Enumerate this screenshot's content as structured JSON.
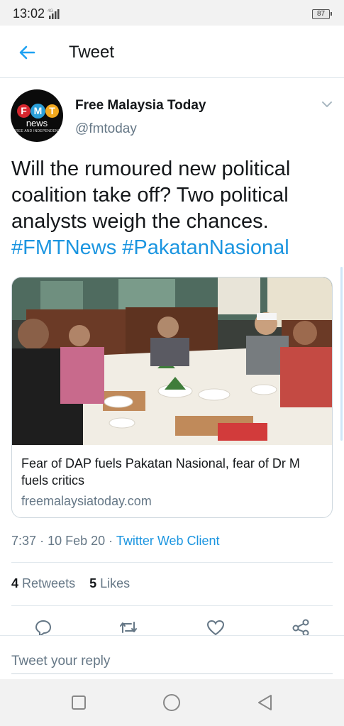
{
  "status_bar": {
    "time": "13:02",
    "network": "4G",
    "battery": "87"
  },
  "header": {
    "title": "Tweet"
  },
  "author": {
    "name": "Free Malaysia Today",
    "handle": "@fmtoday",
    "avatar_logo": {
      "letters": [
        "F",
        "M",
        "T"
      ],
      "word": "news",
      "tagline": "FREE AND INDEPENDENT"
    }
  },
  "tweet": {
    "text_line1": "Will the rumoured new political",
    "text_line2": "coalition take off? Two political",
    "text_line3": "analysts weigh the chances.",
    "hashtag1": "#FMTNews",
    "hashtag2": "#PakatanNasional"
  },
  "card": {
    "title": "Fear of DAP fuels Pakatan Nasional, fear of Dr M fuels critics",
    "domain": "freemalaysiatoday.com"
  },
  "meta": {
    "time": "7:37",
    "date": "10 Feb 20",
    "client": "Twitter Web Client",
    "separator": "·"
  },
  "stats": {
    "retweets_count": "4",
    "retweets_label": "Retweets",
    "likes_count": "5",
    "likes_label": "Likes"
  },
  "actions": [
    "reply-icon",
    "retweet-icon",
    "like-icon",
    "share-icon"
  ],
  "reply": {
    "placeholder": "Tweet your reply"
  },
  "nav": [
    "square-icon",
    "circle-icon",
    "triangle-back-icon"
  ],
  "colors": {
    "accent": "#1b95e0",
    "text": "#14171a",
    "secondary": "#657786",
    "border": "#e1e8ed"
  }
}
